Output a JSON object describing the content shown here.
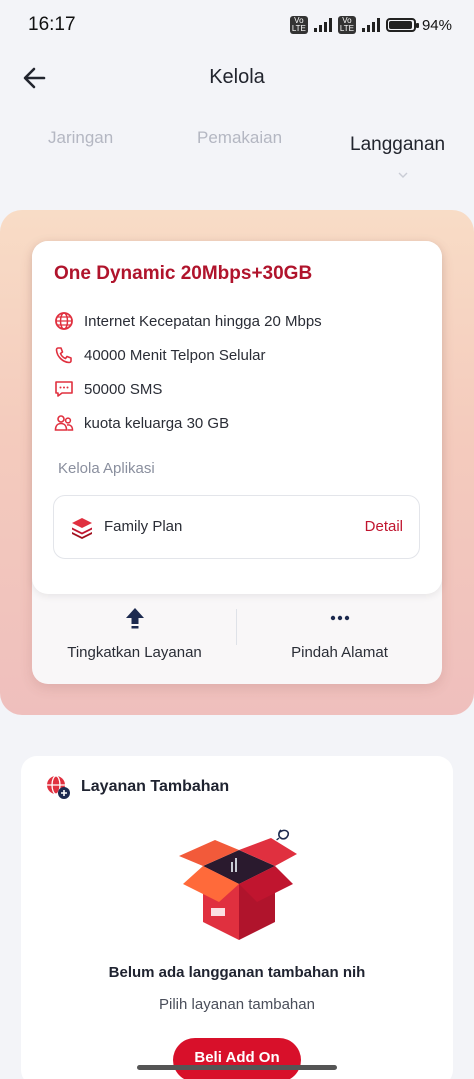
{
  "status_bar": {
    "time": "16:17",
    "battery": "94",
    "network": "4G",
    "lte_label": "Vo LTE"
  },
  "header": {
    "title": "Kelola",
    "back_icon": "arrow-left-icon"
  },
  "tabs": [
    {
      "label": "Jaringan",
      "active": false
    },
    {
      "label": "Pemakaian",
      "active": false
    },
    {
      "label": "Langganan",
      "active": true
    }
  ],
  "plan": {
    "name": "One Dynamic 20Mbps+30GB",
    "features": [
      {
        "icon": "globe-icon",
        "text": "Internet Kecepatan hingga 20 Mbps"
      },
      {
        "icon": "phone-icon",
        "text": "40000 Menit Telpon Selular"
      },
      {
        "icon": "sms-icon",
        "text": "50000 SMS"
      },
      {
        "icon": "family-icon",
        "text": "kuota keluarga 30 GB"
      }
    ],
    "apps_label": "Kelola Aplikasi",
    "app": {
      "name": "Family Plan",
      "action": "Detail"
    },
    "actions": [
      {
        "icon": "upgrade-arrow-icon",
        "label": "Tingkatkan Layanan"
      },
      {
        "icon": "more-dots-icon",
        "label": "Pindah Alamat"
      }
    ]
  },
  "addon": {
    "title": "Layanan Tambahan",
    "empty_title": "Belum ada langganan tambahan nih",
    "empty_subtitle": "Pilih layanan tambahan",
    "button_label": "Beli Add On"
  },
  "colors": {
    "brand_red": "#d8102a",
    "title_red": "#b0142c"
  }
}
